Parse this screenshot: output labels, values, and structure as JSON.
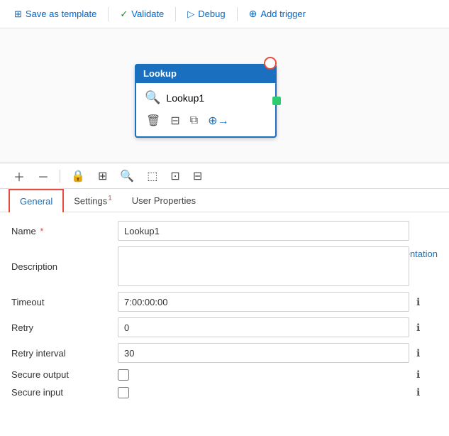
{
  "toolbar": {
    "save_label": "Save as template",
    "validate_label": "Validate",
    "debug_label": "Debug",
    "add_trigger_label": "Add trigger"
  },
  "canvas": {
    "node": {
      "header": "Lookup",
      "name": "Lookup1"
    }
  },
  "tabs": [
    {
      "label": "General",
      "badge": "",
      "active": true
    },
    {
      "label": "Settings",
      "badge": "1",
      "active": false
    },
    {
      "label": "User Properties",
      "badge": "",
      "active": false
    }
  ],
  "form": {
    "name_label": "Name",
    "name_value": "Lookup1",
    "name_placeholder": "Lookup1",
    "description_label": "Description",
    "description_value": "",
    "timeout_label": "Timeout",
    "timeout_value": "7:00:00:00",
    "retry_label": "Retry",
    "retry_value": "0",
    "retry_interval_label": "Retry interval",
    "retry_interval_value": "30",
    "secure_output_label": "Secure output",
    "secure_input_label": "Secure input",
    "doc_label": "Documentation"
  },
  "icons": {
    "save": "⬛",
    "validate": "✓",
    "debug": "▷",
    "trigger": "⊕",
    "info": "ℹ",
    "doc_link": "↗"
  }
}
